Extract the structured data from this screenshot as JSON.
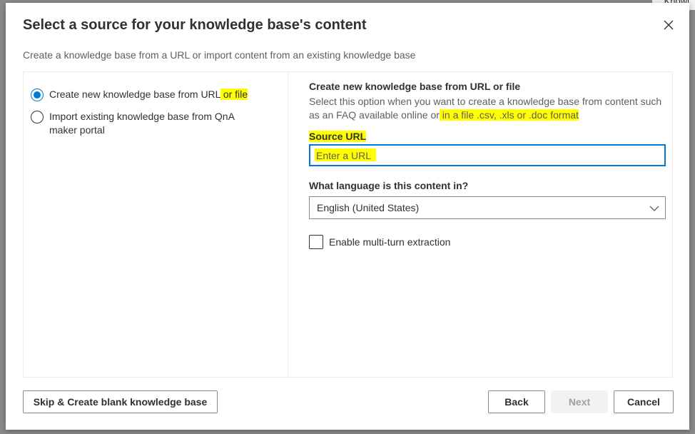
{
  "background": {
    "partial_text": "Knowl"
  },
  "dialog": {
    "title": "Select a source for your knowledge base's content",
    "subtitle": "Create a knowledge base from a URL or import content from an existing knowledge base",
    "options": [
      {
        "label_main": "Create new knowledge base from URL",
        "label_highlight": " or file",
        "selected": true
      },
      {
        "label": "Import existing knowledge base from QnA maker portal",
        "selected": false
      }
    ],
    "section": {
      "title": "Create new knowledge base from URL or file",
      "desc_main": "Select this option when you want to create a knowledge base from content such as an FAQ available online or",
      "desc_highlight": " in a file .csv, .xls or .doc format"
    },
    "source_url": {
      "label": "Source URL",
      "placeholder": "Enter a URL",
      "value": ""
    },
    "language": {
      "label": "What language is this content in?",
      "selected": "English (United States)"
    },
    "multi_turn": {
      "label": "Enable multi-turn extraction",
      "checked": false
    },
    "buttons": {
      "skip": "Skip & Create blank knowledge base",
      "back": "Back",
      "next": "Next",
      "cancel": "Cancel"
    }
  },
  "colors": {
    "accent": "#0078d4",
    "highlight": "#ffff00"
  },
  "icons": {
    "close": "close-icon",
    "dropdown": "chevron-down-icon"
  }
}
